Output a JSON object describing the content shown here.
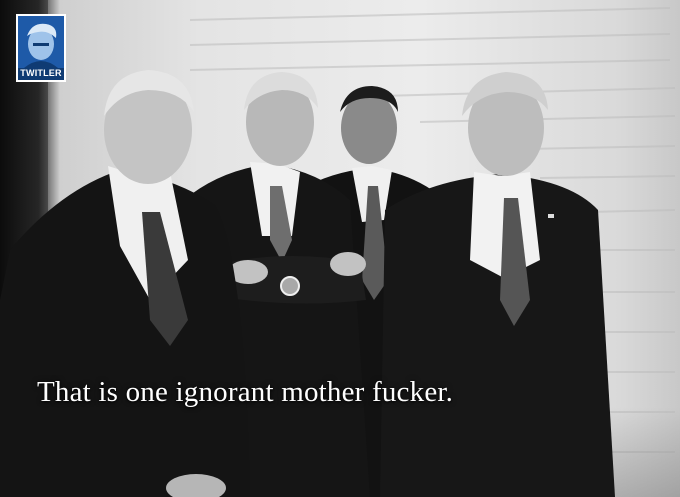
{
  "image": {
    "caption": "That is one ignorant mother fucker.",
    "logo": {
      "text": "TWITLER",
      "icon": "portrait-icon",
      "color": "#0f3b73"
    },
    "palette": {
      "wall": "#e6e6e6",
      "suit": "#141414",
      "shirt": "#f2f2f2",
      "skin": "#bdbdbd",
      "hair": "#d8d8d8"
    }
  }
}
